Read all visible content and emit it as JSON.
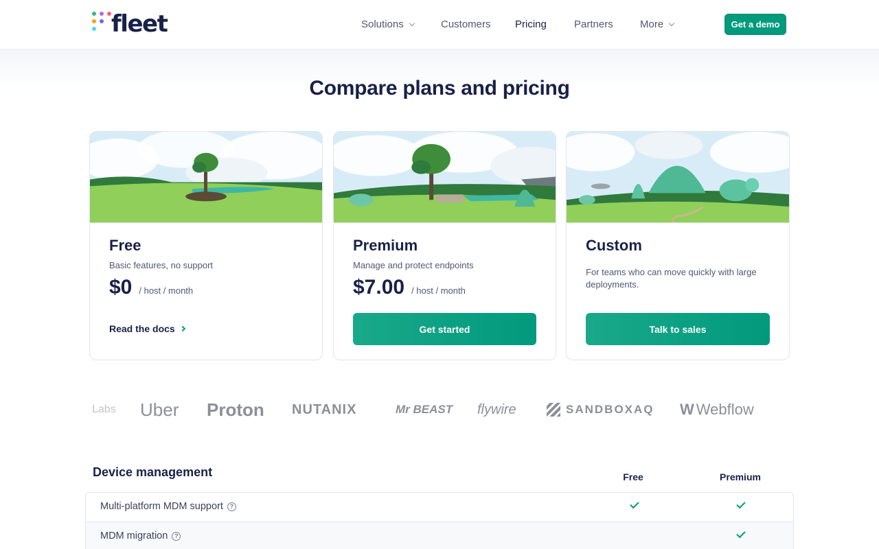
{
  "header": {
    "logo_text": "fleet",
    "nav": [
      {
        "label": "Solutions",
        "has_menu": true
      },
      {
        "label": "Customers",
        "has_menu": false
      },
      {
        "label": "Pricing",
        "has_menu": false,
        "active": true
      },
      {
        "label": "Partners",
        "has_menu": false
      },
      {
        "label": "More",
        "has_menu": true
      }
    ],
    "demo_button": "Get a demo"
  },
  "page_title": "Compare plans and pricing",
  "plans": [
    {
      "name": "Free",
      "description": "Basic features, no support",
      "price": "$0",
      "unit": "/ host / month",
      "link": "Read the docs"
    },
    {
      "name": "Premium",
      "description": "Manage and protect endpoints",
      "price": "$7.00",
      "unit": "/ host / month",
      "cta": "Get started"
    },
    {
      "name": "Custom",
      "description": "For teams who can move quickly with large deployments.",
      "cta": "Talk to sales"
    }
  ],
  "customer_logos": [
    "Labs",
    "Uber",
    "Proton",
    "NUTANIX",
    "Mr BEAST",
    "flywire",
    "SANDBOXAQ",
    "Webflow"
  ],
  "comparison": {
    "section": "Device management",
    "columns": [
      "Free",
      "Premium"
    ],
    "rows": [
      {
        "feature": "Multi-platform MDM support",
        "free": true,
        "premium": true
      },
      {
        "feature": "MDM migration",
        "free": false,
        "premium": true
      }
    ]
  },
  "colors": {
    "accent": "#009a7d",
    "text": "#192147",
    "muted": "#515774"
  }
}
